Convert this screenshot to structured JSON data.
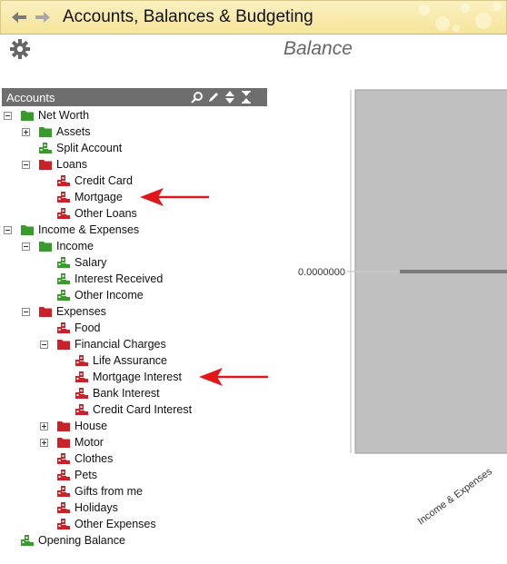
{
  "app": {
    "title": "Accounts, Balances & Budgeting",
    "page_title": "Balance"
  },
  "accounts_panel": {
    "header": "Accounts",
    "tools": [
      "search-icon",
      "edit-icon",
      "sort-icon",
      "collapse-icon"
    ]
  },
  "tree": [
    {
      "label": "Net Worth",
      "level": 0,
      "expander": "minus",
      "icon": "folder-green"
    },
    {
      "label": "Assets",
      "level": 1,
      "expander": "plus",
      "icon": "folder-green"
    },
    {
      "label": "Split Account",
      "level": 1,
      "expander": "none",
      "icon": "account-green"
    },
    {
      "label": "Loans",
      "level": 1,
      "expander": "minus",
      "icon": "folder-red"
    },
    {
      "label": "Credit Card",
      "level": 2,
      "expander": "none",
      "icon": "account-red"
    },
    {
      "label": "Mortgage",
      "level": 2,
      "expander": "none",
      "icon": "account-red",
      "arrow": true
    },
    {
      "label": "Other Loans",
      "level": 2,
      "expander": "none",
      "icon": "account-red"
    },
    {
      "label": "Income & Expenses",
      "level": 0,
      "expander": "minus",
      "icon": "folder-green"
    },
    {
      "label": "Income",
      "level": 1,
      "expander": "minus",
      "icon": "folder-green"
    },
    {
      "label": "Salary",
      "level": 2,
      "expander": "none",
      "icon": "account-green"
    },
    {
      "label": "Interest Received",
      "level": 2,
      "expander": "none",
      "icon": "account-green"
    },
    {
      "label": "Other Income",
      "level": 2,
      "expander": "none",
      "icon": "account-green"
    },
    {
      "label": "Expenses",
      "level": 1,
      "expander": "minus",
      "icon": "folder-red"
    },
    {
      "label": "Food",
      "level": 2,
      "expander": "none",
      "icon": "account-red"
    },
    {
      "label": "Financial Charges",
      "level": 2,
      "expander": "minus",
      "icon": "folder-red"
    },
    {
      "label": "Life Assurance",
      "level": 3,
      "expander": "none",
      "icon": "account-red"
    },
    {
      "label": "Mortgage Interest",
      "level": 3,
      "expander": "none",
      "icon": "account-red",
      "arrow": true
    },
    {
      "label": "Bank Interest",
      "level": 3,
      "expander": "none",
      "icon": "account-red"
    },
    {
      "label": "Credit Card Interest",
      "level": 3,
      "expander": "none",
      "icon": "account-red"
    },
    {
      "label": "House",
      "level": 2,
      "expander": "plus",
      "icon": "folder-red"
    },
    {
      "label": "Motor",
      "level": 2,
      "expander": "plus",
      "icon": "folder-red"
    },
    {
      "label": "Clothes",
      "level": 2,
      "expander": "none",
      "icon": "account-red"
    },
    {
      "label": "Pets",
      "level": 2,
      "expander": "none",
      "icon": "account-red"
    },
    {
      "label": "Gifts from me",
      "level": 2,
      "expander": "none",
      "icon": "account-red"
    },
    {
      "label": "Holidays",
      "level": 2,
      "expander": "none",
      "icon": "account-red"
    },
    {
      "label": "Other Expenses",
      "level": 2,
      "expander": "none",
      "icon": "account-red"
    },
    {
      "label": "Opening Balance",
      "level": 0,
      "expander": "none",
      "icon": "account-green"
    }
  ],
  "colors": {
    "green": "#3a9a2e",
    "red": "#c8232a",
    "arrow": "#e0161b",
    "header_bg": "#6e6e6e",
    "titlebar": "#f6e49a",
    "plot_bg": "#c0c0c0"
  },
  "chart_data": {
    "type": "bar",
    "categories": [
      "Income & Expenses"
    ],
    "values": [
      0
    ],
    "y_tick_labels": [
      "0.0000000"
    ],
    "grid": false
  }
}
